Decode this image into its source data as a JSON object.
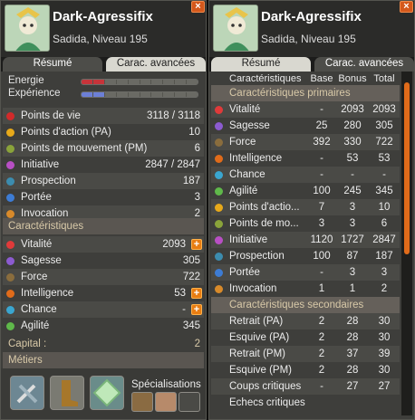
{
  "left": {
    "char_name": "Dark-Agressifix",
    "class_level": "Sadida, Niveau 195",
    "close": "×",
    "tabs": [
      "Résumé",
      "Carac. avancées"
    ],
    "energy_label": "Energie",
    "xp_label": "Expérience",
    "energy_fill_segments": 2,
    "xp_fill_segments": 2,
    "stats": [
      {
        "label": "Points de vie",
        "value": "3118 / 3118",
        "icon": "heart-icon",
        "color": "#d22a2a"
      },
      {
        "label": "Points d'action (PA)",
        "value": "10",
        "icon": "star-icon",
        "color": "#e7a91a"
      },
      {
        "label": "Points de mouvement (PM)",
        "value": "6",
        "icon": "boot-icon",
        "color": "#8aa33a"
      },
      {
        "label": "Initiative",
        "value": "2847 / 2847",
        "icon": "initiative-icon",
        "color": "#b84fc4"
      },
      {
        "label": "Prospection",
        "value": "187",
        "icon": "prospection-icon",
        "color": "#3c8cae"
      },
      {
        "label": "Portée",
        "value": "3",
        "icon": "range-icon",
        "color": "#3d7cd4"
      },
      {
        "label": "Invocation",
        "value": "2",
        "icon": "invocation-icon",
        "color": "#d88a2a"
      }
    ],
    "carac_title": "Caractéristiques",
    "caracs": [
      {
        "label": "Vitalité",
        "value": "2093",
        "icon": "vitality-icon",
        "color": "#e03a3a",
        "plus": true
      },
      {
        "label": "Sagesse",
        "value": "305",
        "icon": "wisdom-icon",
        "color": "#8c5bd0",
        "plus": false
      },
      {
        "label": "Force",
        "value": "722",
        "icon": "strength-icon",
        "color": "#8a6d3d",
        "plus": false
      },
      {
        "label": "Intelligence",
        "value": "53",
        "icon": "intelligence-icon",
        "color": "#e06b1a",
        "plus": true
      },
      {
        "label": "Chance",
        "value": "-",
        "icon": "chance-icon",
        "color": "#3aa6d0",
        "plus": true
      },
      {
        "label": "Agilité",
        "value": "345",
        "icon": "agility-icon",
        "color": "#5fb84a",
        "plus": false
      }
    ],
    "capital_label": "Capital :",
    "capital_value": "2",
    "metiers_title": "Métiers",
    "specialisations_label": "Spécialisations",
    "plus": "+"
  },
  "right": {
    "char_name": "Dark-Agressifix",
    "class_level": "Sadida, Niveau 195",
    "close": "×",
    "tabs": [
      "Résumé",
      "Carac. avancées"
    ],
    "columns": [
      "Caractéristiques",
      "Base",
      "Bonus",
      "Total"
    ],
    "primary_title": "Caractéristiques primaires",
    "primary": [
      {
        "label": "Vitalité",
        "base": "-",
        "bonus": "2093",
        "total": "2093",
        "icon": "vitality-icon",
        "color": "#e03a3a"
      },
      {
        "label": "Sagesse",
        "base": "25",
        "bonus": "280",
        "total": "305",
        "icon": "wisdom-icon",
        "color": "#8c5bd0"
      },
      {
        "label": "Force",
        "base": "392",
        "bonus": "330",
        "total": "722",
        "icon": "strength-icon",
        "color": "#8a6d3d"
      },
      {
        "label": "Intelligence",
        "base": "-",
        "bonus": "53",
        "total": "53",
        "icon": "intelligence-icon",
        "color": "#e06b1a"
      },
      {
        "label": "Chance",
        "base": "-",
        "bonus": "-",
        "total": "-",
        "icon": "chance-icon",
        "color": "#3aa6d0"
      },
      {
        "label": "Agilité",
        "base": "100",
        "bonus": "245",
        "total": "345",
        "icon": "agility-icon",
        "color": "#5fb84a"
      },
      {
        "label": "Points d'actio...",
        "base": "7",
        "bonus": "3",
        "total": "10",
        "icon": "star-icon",
        "color": "#e7a91a"
      },
      {
        "label": "Points de mo...",
        "base": "3",
        "bonus": "3",
        "total": "6",
        "icon": "boot-icon",
        "color": "#8aa33a"
      },
      {
        "label": "Initiative",
        "base": "1120",
        "bonus": "1727",
        "total": "2847",
        "icon": "initiative-icon",
        "color": "#b84fc4"
      },
      {
        "label": "Prospection",
        "base": "100",
        "bonus": "87",
        "total": "187",
        "icon": "prospection-icon",
        "color": "#3c8cae"
      },
      {
        "label": "Portée",
        "base": "-",
        "bonus": "3",
        "total": "3",
        "icon": "range-icon",
        "color": "#3d7cd4"
      },
      {
        "label": "Invocation",
        "base": "1",
        "bonus": "1",
        "total": "2",
        "icon": "invocation-icon",
        "color": "#d88a2a"
      }
    ],
    "secondary_title": "Caractéristiques secondaires",
    "secondary": [
      {
        "label": "Retrait (PA)",
        "base": "2",
        "bonus": "28",
        "total": "30"
      },
      {
        "label": "Esquive (PA)",
        "base": "2",
        "bonus": "28",
        "total": "30"
      },
      {
        "label": "Retrait (PM)",
        "base": "2",
        "bonus": "37",
        "total": "39"
      },
      {
        "label": "Esquive (PM)",
        "base": "2",
        "bonus": "28",
        "total": "30"
      },
      {
        "label": "Coups critiques",
        "base": "-",
        "bonus": "27",
        "total": "27"
      },
      {
        "label": "Echecs critiques",
        "base": "",
        "bonus": "",
        "total": ""
      }
    ]
  }
}
